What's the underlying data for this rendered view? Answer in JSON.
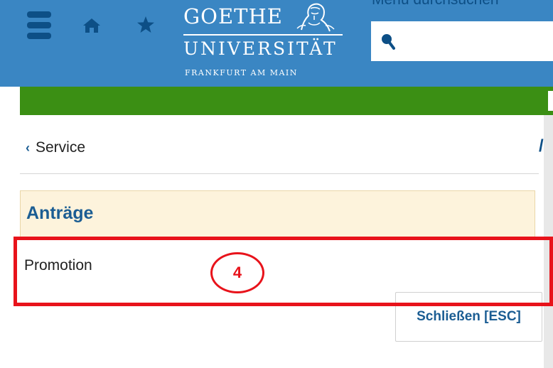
{
  "header": {
    "logo": {
      "line1": "GOETHE",
      "line2": "UNIVERSITÄT",
      "line3": "FRANKFURT AM MAIN"
    },
    "search": {
      "label": "Menü durchsuchen",
      "value": "",
      "placeholder": ""
    },
    "icons": [
      "menu-icon",
      "home-icon",
      "star-icon",
      "search-icon"
    ]
  },
  "nav": {
    "back_label": "Service",
    "right_glyph": "/("
  },
  "section": {
    "title": "Anträge",
    "items": [
      {
        "label": "Promotion"
      }
    ]
  },
  "dialog": {
    "close_label": "Schließen [ESC]"
  },
  "annotation": {
    "step_number": "4"
  },
  "colors": {
    "header_blue": "#3a86c3",
    "dark_blue": "#0d4f86",
    "green_bar": "#3b8f14",
    "section_bg": "#fdf3dc",
    "highlight_red": "#e8131b"
  }
}
